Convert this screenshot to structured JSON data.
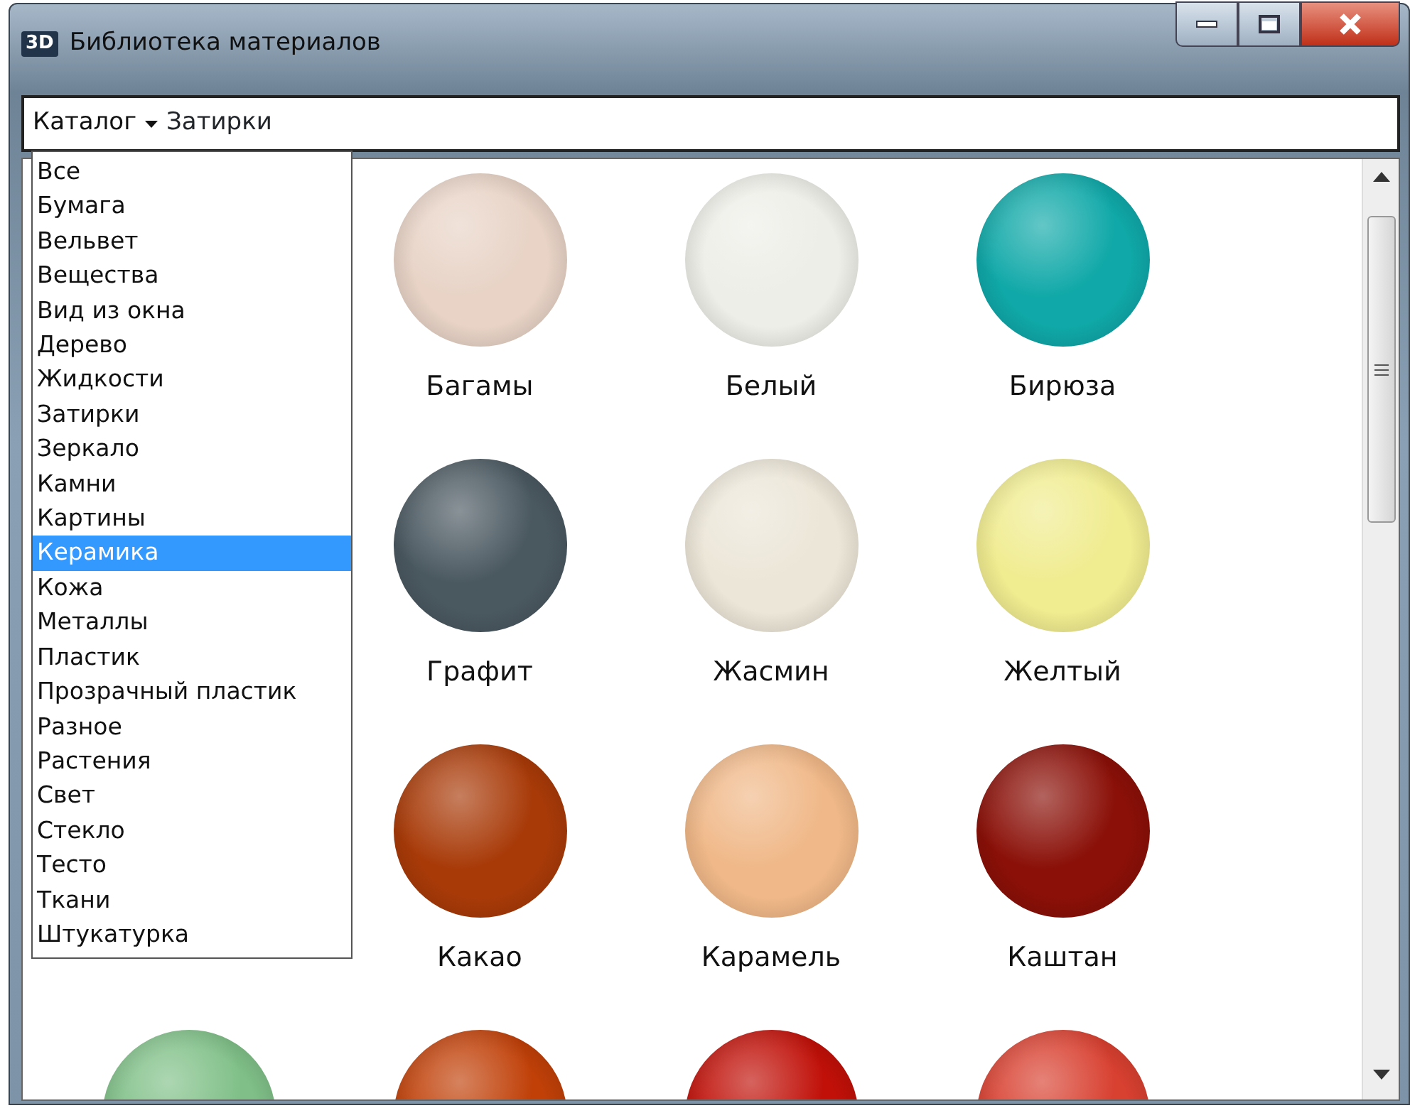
{
  "window": {
    "title": "Библиотека материалов",
    "icon_text": "3D"
  },
  "address_bar": {
    "menu": "Каталог",
    "path": "Затирки"
  },
  "catalog_dropdown": {
    "items": [
      {
        "label": "Все",
        "selected": false
      },
      {
        "label": "Бумага",
        "selected": false
      },
      {
        "label": "Вельвет",
        "selected": false
      },
      {
        "label": "Вещества",
        "selected": false
      },
      {
        "label": "Вид из окна",
        "selected": false
      },
      {
        "label": "Дерево",
        "selected": false
      },
      {
        "label": "Жидкости",
        "selected": false
      },
      {
        "label": "Затирки",
        "selected": false
      },
      {
        "label": "Зеркало",
        "selected": false
      },
      {
        "label": "Камни",
        "selected": false
      },
      {
        "label": "Картины",
        "selected": false
      },
      {
        "label": "Керамика",
        "selected": true
      },
      {
        "label": "Кожа",
        "selected": false
      },
      {
        "label": "Металлы",
        "selected": false
      },
      {
        "label": "Пластик",
        "selected": false
      },
      {
        "label": "Прозрачный пластик",
        "selected": false
      },
      {
        "label": "Разное",
        "selected": false
      },
      {
        "label": "Растения",
        "selected": false
      },
      {
        "label": "Свет",
        "selected": false
      },
      {
        "label": "Стекло",
        "selected": false
      },
      {
        "label": "Тесто",
        "selected": false
      },
      {
        "label": "Ткани",
        "selected": false
      },
      {
        "label": "Штукатурка",
        "selected": false
      }
    ]
  },
  "materials": {
    "rows": [
      {
        "items": [
          {
            "name": "Багамы",
            "color": "#e8d3c6"
          },
          {
            "name": "Белый",
            "color": "#eeeee8"
          },
          {
            "name": "Бирюза",
            "color": "#10a8a8"
          }
        ]
      },
      {
        "items": [
          {
            "name": "Графит",
            "color": "#4a5860"
          },
          {
            "name": "Жасмин",
            "color": "#ece6d8"
          },
          {
            "name": "Желтый",
            "color": "#f0ec90"
          }
        ]
      },
      {
        "items": [
          {
            "name": "Какао",
            "color": "#a83a08"
          },
          {
            "name": "Карамель",
            "color": "#f0b888"
          },
          {
            "name": "Каштан",
            "color": "#8a1008"
          }
        ]
      },
      {
        "items": [
          {
            "color": "#80c088"
          },
          {
            "color": "#c04008"
          },
          {
            "color": "#c01008"
          },
          {
            "color": "#d84030"
          }
        ]
      }
    ]
  }
}
